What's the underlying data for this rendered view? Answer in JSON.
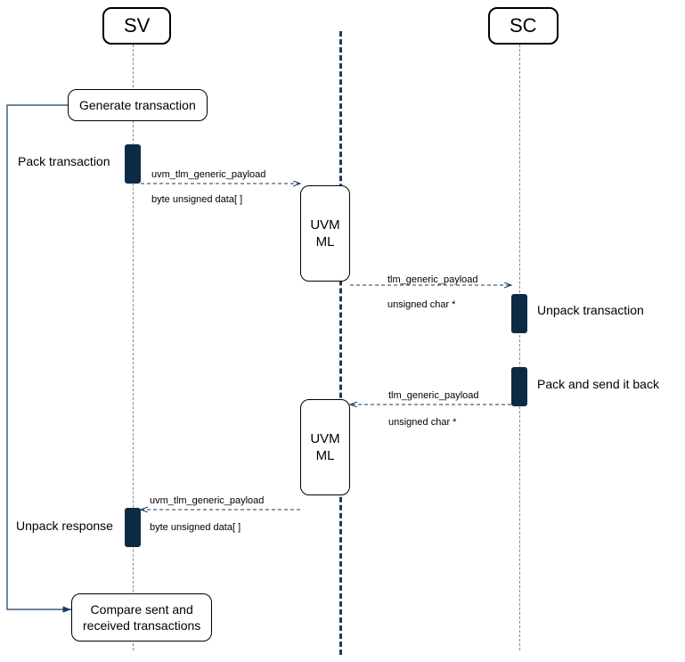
{
  "headers": {
    "sv": "SV",
    "sc": "SC"
  },
  "nodes": {
    "generate": "Generate transaction",
    "compare": "Compare sent and\nreceived transactions",
    "uvm1": "UVM\nML",
    "uvm2": "UVM\nML"
  },
  "sideLabels": {
    "pack_tx": "Pack transaction",
    "unpack_resp": "Unpack response",
    "unpack_tx": "Unpack  transaction",
    "pack_back": "Pack and send it back"
  },
  "msgs": {
    "m1a": "uvm_tlm_generic_payload",
    "m1b": "byte unsigned data[ ]",
    "m2a": "tlm_generic_payload",
    "m2b": "unsigned char *",
    "m3a": "tlm_generic_payload",
    "m3b": "unsigned char *",
    "m4a": "uvm_tlm_generic_payload",
    "m4b": "byte unsigned data[ ]"
  }
}
